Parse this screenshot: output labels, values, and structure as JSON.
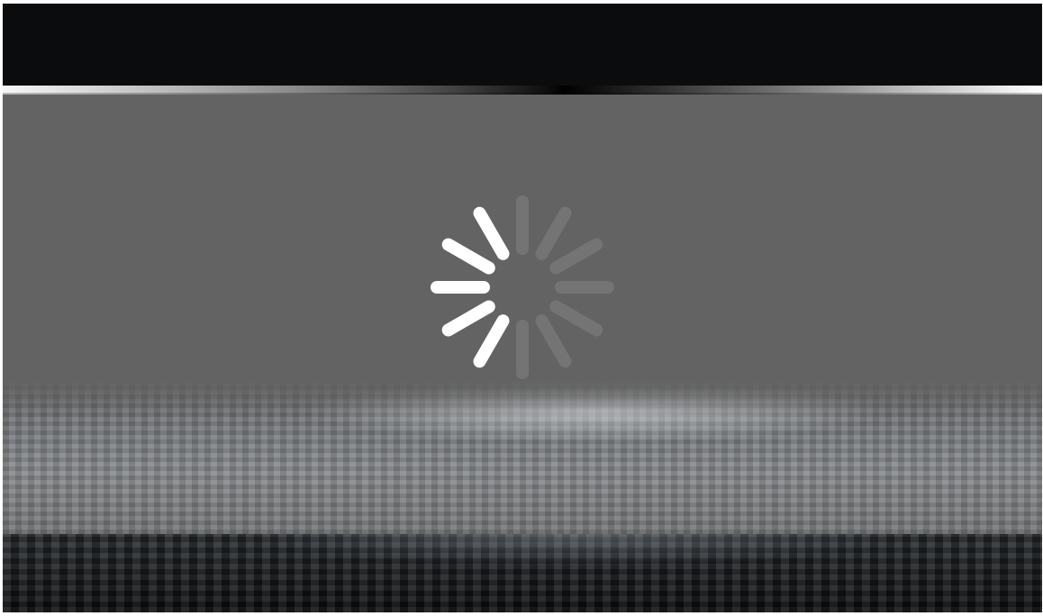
{
  "loading_screen": {
    "spinner": {
      "icon": "loading-spinner-icon",
      "segments": 12,
      "active_color": "#ffffff",
      "inactive_color": "#7a7a7a",
      "segment_opacities": [
        0.25,
        0.25,
        0.25,
        0.25,
        0.25,
        0.25,
        0.25,
        1,
        1,
        1,
        1,
        1
      ]
    },
    "colors": {
      "top_bar": "#0b0c0e",
      "stage": "#636363",
      "bottom_band": "#1a1c1f"
    }
  }
}
